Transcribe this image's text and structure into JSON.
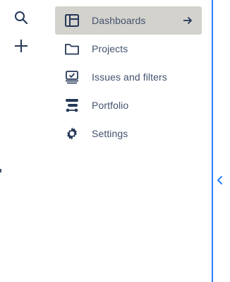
{
  "rail": {
    "search_icon": "search-icon",
    "create_icon": "plus-icon"
  },
  "menu": {
    "items": [
      {
        "label": "Dashboards",
        "icon": "dashboard-icon",
        "active": true
      },
      {
        "label": "Projects",
        "icon": "folder-icon",
        "active": false
      },
      {
        "label": "Issues and filters",
        "icon": "issues-icon",
        "active": false
      },
      {
        "label": "Portfolio",
        "icon": "portfolio-icon",
        "active": false
      },
      {
        "label": "Settings",
        "icon": "gear-icon",
        "active": false
      }
    ]
  },
  "colors": {
    "text": "#42526e",
    "active_bg": "#d4d2cc",
    "accent": "#2684ff"
  }
}
